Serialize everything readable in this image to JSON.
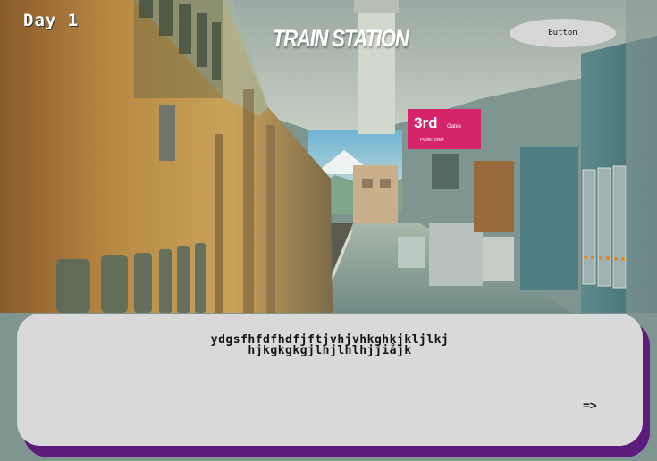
{
  "hud": {
    "day": "Day 1",
    "location_title": "TRAIN STATION",
    "menu_button": "Button"
  },
  "scene": {
    "sign_main": "3rd",
    "sign_small": "Gates",
    "sign_sub": "Public Toilet"
  },
  "dialog": {
    "line1": "ydgsfhfdfhdfjftjvhjvhkghkjkljlkj",
    "line2": "hjkgkgkgjlhjlhlhjjiåjk",
    "next": "=>"
  },
  "colors": {
    "dialog_bg": "#d9d9d9",
    "dialog_shadow": "#5b1c7c",
    "button_bg": "#d7d7d7",
    "sign_bg": "#d6246a"
  }
}
